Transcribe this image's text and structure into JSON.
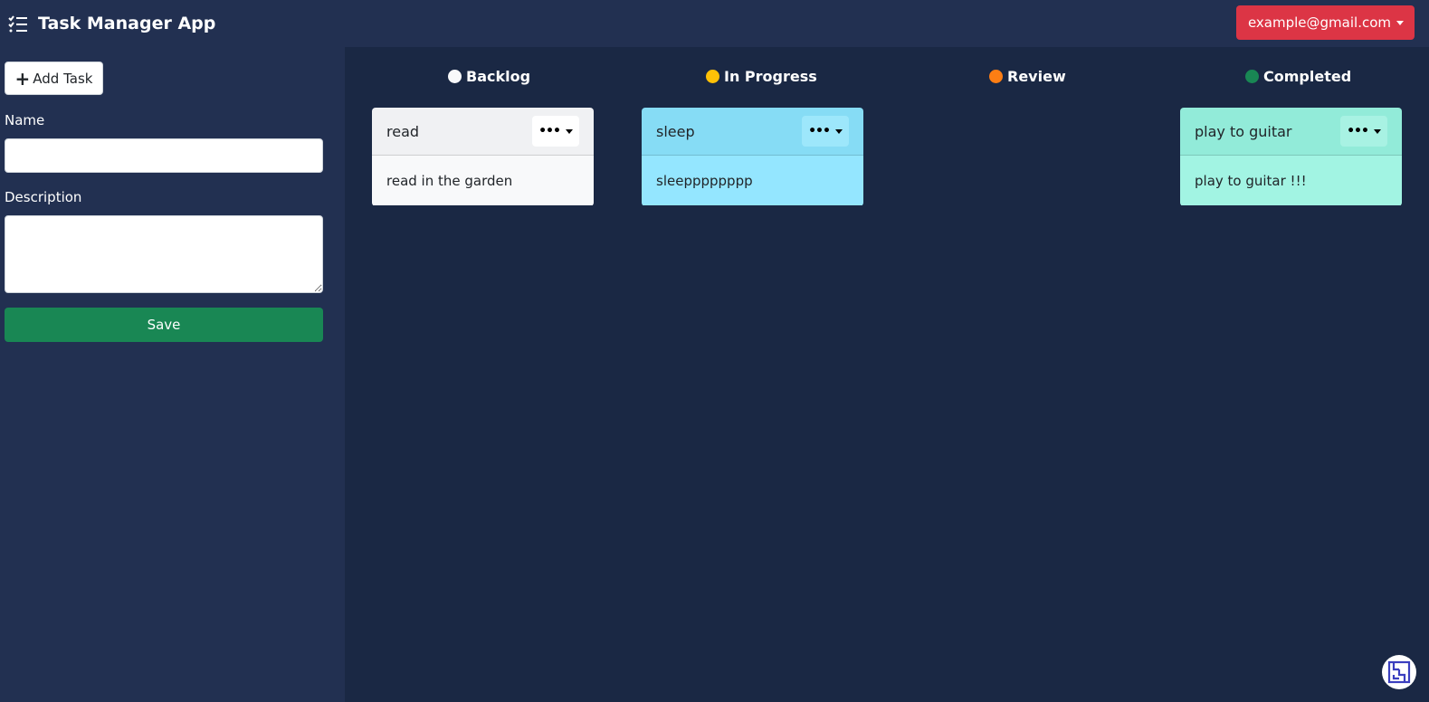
{
  "navbar": {
    "brand_icon": "task-list-icon",
    "title": "Task Manager App",
    "user_email": "example@gmail.com"
  },
  "sidebar": {
    "add_task_label": "Add Task",
    "name_label": "Name",
    "name_value": "",
    "description_label": "Description",
    "description_value": "",
    "save_label": "Save"
  },
  "columns": [
    {
      "title": "Backlog",
      "dot_color": "#f8f9fa"
    },
    {
      "title": "In Progress",
      "dot_color": "#ffc107"
    },
    {
      "title": "Review",
      "dot_color": "#fd7e14"
    },
    {
      "title": "Completed",
      "dot_color": "#198754"
    }
  ],
  "cards": [
    {
      "title": "read",
      "description": "read in the garden",
      "header_color": "#f0f1f3",
      "body_color": "#f8f9fa",
      "menu_color": "#ffffff"
    },
    {
      "title": "sleep",
      "description": "sleepppppppp",
      "header_color": "#86dcf5",
      "body_color": "#94e6ff",
      "menu_color": "#9de7fb"
    },
    {
      "title": "play to guitar",
      "description": "play to guitar !!!",
      "header_color": "#92ebd9",
      "body_color": "#a2f4e3",
      "menu_color": "#a8f2e3"
    }
  ],
  "colors": {
    "navbar": "#223051",
    "board": "#1a2844",
    "danger": "#dc3545",
    "success": "#198754"
  }
}
